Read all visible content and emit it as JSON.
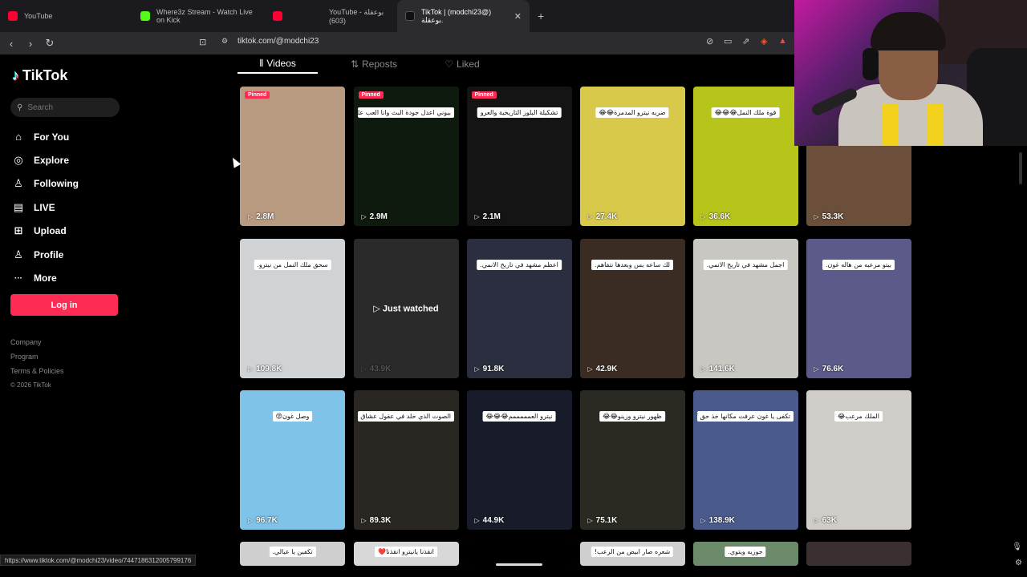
{
  "browser": {
    "tabs": [
      {
        "title": "YouTube",
        "favicon_color": "#ff0033",
        "active": false
      },
      {
        "title": "Where3z Stream - Watch Live on Kick",
        "favicon_color": "#53fc18",
        "active": false
      },
      {
        "title": "YouTube - بوعقلة (603)",
        "favicon_color": "#ff0033",
        "active": false
      },
      {
        "title": "TikTok | (modchi23@) بوعقلة.",
        "favicon_color": "#111111",
        "active": true
      }
    ],
    "new_tab": "+",
    "tab_close": "✕",
    "url": "tiktok.com/@modchi23",
    "status_url": "https://www.tiktok.com/@modchi23/video/7447186312005799176"
  },
  "sidebar": {
    "logo_text": "TikTok",
    "search_placeholder": "Search",
    "nav": [
      {
        "label": "For You",
        "icon": "home-icon",
        "glyph": "⌂"
      },
      {
        "label": "Explore",
        "icon": "compass-icon",
        "glyph": "◎"
      },
      {
        "label": "Following",
        "icon": "user-plus-icon",
        "glyph": "♙"
      },
      {
        "label": "LIVE",
        "icon": "live-icon",
        "glyph": "▤"
      },
      {
        "label": "Upload",
        "icon": "upload-icon",
        "glyph": "⊞"
      },
      {
        "label": "Profile",
        "icon": "profile-icon",
        "glyph": "♙"
      },
      {
        "label": "More",
        "icon": "more-icon",
        "glyph": "···"
      }
    ],
    "login_label": "Log in",
    "footer": {
      "company": "Company",
      "program": "Program",
      "terms": "Terms & Policies",
      "copyright": "© 2026 TikTok"
    }
  },
  "profile_tabs": [
    {
      "label": "Videos",
      "icon": "grid-icon",
      "glyph": "⦀",
      "active": true
    },
    {
      "label": "Reposts",
      "icon": "repost-icon",
      "glyph": "⇅",
      "active": false
    },
    {
      "label": "Liked",
      "icon": "heart-icon",
      "glyph": "♡",
      "active": false
    }
  ],
  "colors": {
    "accent": "#fe2c55",
    "background": "#000000",
    "text_secondary": "#8a8a8a"
  },
  "videos": [
    {
      "views": "2.8M",
      "pinned": "Pinned",
      "caption": "",
      "bg": "#b89a80"
    },
    {
      "views": "2.9M",
      "pinned": "Pinned",
      "caption": "بيوني اعدل جودة البث وانا العب على كرسي قاعات😂",
      "bg": "#0e1a0e"
    },
    {
      "views": "2.1M",
      "pinned": "Pinned",
      "caption": "تشكيلة البلوز التاريخية والعرو",
      "bg": "#141414"
    },
    {
      "views": "27.4K",
      "pinned": "",
      "caption": "ضربه نيترو المدمرة😂😂",
      "bg": "#d8c94a"
    },
    {
      "views": "36.6K",
      "pinned": "",
      "caption": "قوة ملك النمل😂😂😂",
      "bg": "#b7c41a"
    },
    {
      "views": "53.3K",
      "pinned": "",
      "caption": "",
      "bg": "#6b4f3a"
    },
    {
      "views": "109.8K",
      "pinned": "",
      "caption": "سحق ملك النمل من نيترو.",
      "bg": "#cfd3d6"
    },
    {
      "views": "43.9K",
      "pinned": "",
      "caption": "",
      "bg": "#2a2a2a",
      "watched": "Just watched",
      "dim": true
    },
    {
      "views": "91.8K",
      "pinned": "",
      "caption": "اعظم مشهد في تاريخ الانمي.",
      "bg": "#2a2e3e"
    },
    {
      "views": "42.9K",
      "pinned": "",
      "caption": "لك ساعه بس وبعدها نتفاهم.",
      "bg": "#3a2c22"
    },
    {
      "views": "141.6K",
      "pinned": "",
      "caption": "اجمل مشهد في تاريخ الانمي.",
      "bg": "#c9c7c2"
    },
    {
      "views": "76.6K",
      "pinned": "",
      "caption": "بيتو مرعبه من هاله غون.",
      "bg": "#5c5a8a"
    },
    {
      "views": "96.7K",
      "pinned": "",
      "caption": "وصل غون😡",
      "bg": "#7fc3e8"
    },
    {
      "views": "89.3K",
      "pinned": "",
      "caption": "الصوت الذي خلد في عقول عشاق الانمي😂😂",
      "bg": "#2a2622"
    },
    {
      "views": "44.9K",
      "pinned": "",
      "caption": "نيترو العمممممم😂😂😂",
      "bg": "#181c2a"
    },
    {
      "views": "75.1K",
      "pinned": "",
      "caption": "ظهور نيترو وزينو😂😂",
      "bg": "#2a2a22"
    },
    {
      "views": "138.9K",
      "pinned": "",
      "caption": "تكفى يا غون عرفت مكانها خذ حق كايتو.",
      "bg": "#4a5a8a"
    },
    {
      "views": "63K",
      "pinned": "",
      "caption": "الملك مرعب😂",
      "bg": "#d0cdc8"
    },
    {
      "views": "",
      "pinned": "",
      "caption": "تكفين يا عيالي.",
      "bg": "#cfcfcf"
    },
    {
      "views": "",
      "pinned": "",
      "caption": "انقذنا يانيترو انقذنا❤️",
      "bg": "#d8d8d8"
    },
    {
      "views": "",
      "pinned": "",
      "caption": "",
      "bg": "#000000"
    },
    {
      "views": "",
      "pinned": "",
      "caption": "شعره صار ابيض من الرعب!",
      "bg": "#cfcfcf"
    },
    {
      "views": "",
      "pinned": "",
      "caption": "جوزيه ويتوي.",
      "bg": "#6a8a6a"
    },
    {
      "views": "",
      "pinned": "",
      "caption": "",
      "bg": "#3a3030"
    }
  ]
}
